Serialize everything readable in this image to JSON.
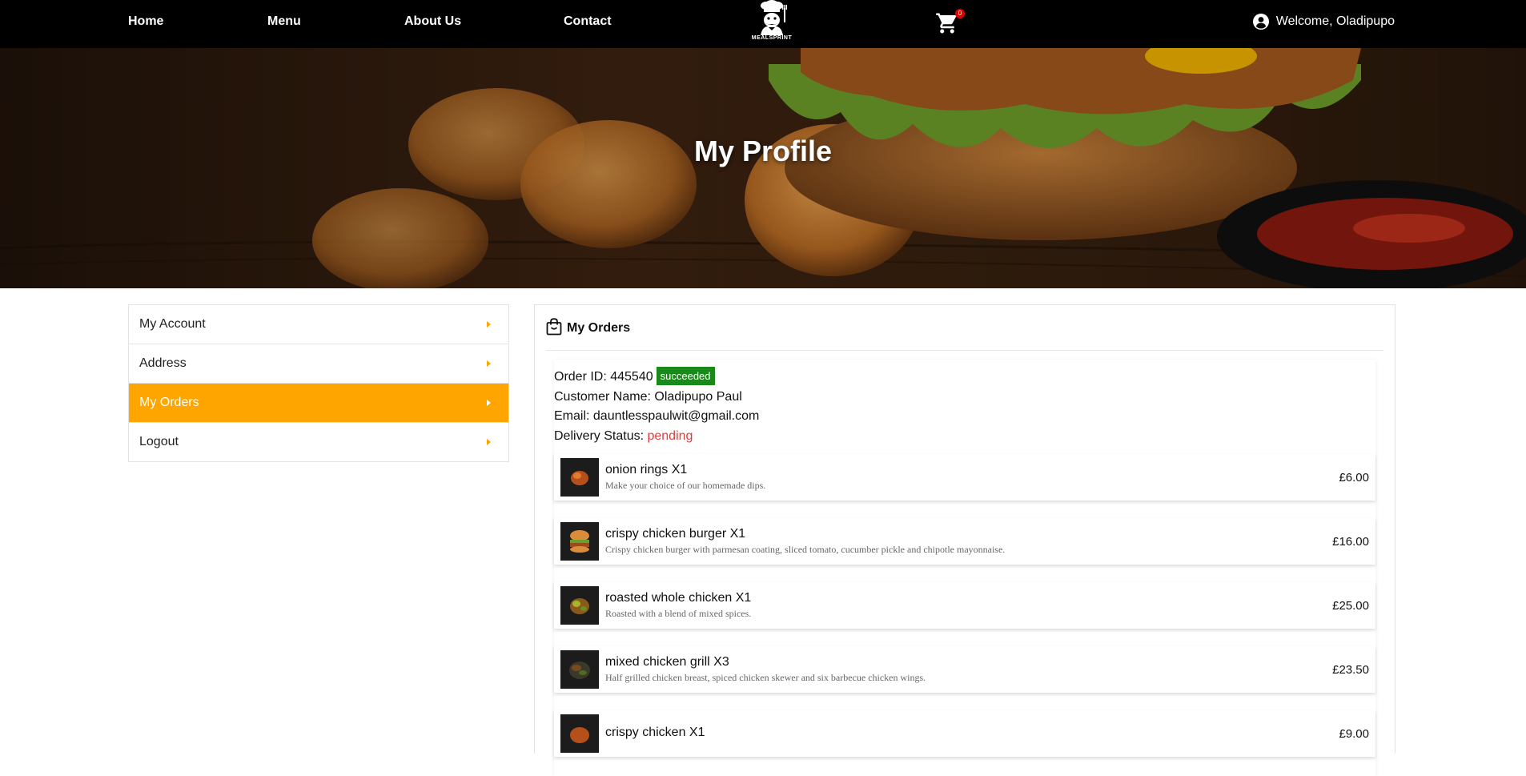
{
  "nav": {
    "links": [
      "Home",
      "Menu",
      "About Us",
      "Contact"
    ],
    "logo_text": "MEALSPRINT",
    "cart_count": "0",
    "welcome": "Welcome, Oladipupo"
  },
  "hero": {
    "title": "My Profile"
  },
  "sidebar": {
    "items": [
      {
        "label": "My Account"
      },
      {
        "label": "Address"
      },
      {
        "label": "My Orders"
      },
      {
        "label": "Logout"
      }
    ]
  },
  "orders": {
    "title": "My Orders",
    "order": {
      "id_label": "Order ID: 445540",
      "status": "succeeded",
      "customer": "Customer Name: Oladipupo Paul",
      "email": "Email: dauntlesspaulwit@gmail.com",
      "delivery_label": "Delivery Status: ",
      "delivery_status": "pending"
    },
    "items": [
      {
        "name": "onion rings X1",
        "desc": "Make your choice of our homemade dips.",
        "price": "£6.00"
      },
      {
        "name": "crispy chicken burger X1",
        "desc": "Crispy chicken burger with parmesan coating, sliced tomato, cucumber pickle and chipotle mayonnaise.",
        "price": "£16.00"
      },
      {
        "name": "roasted whole chicken X1",
        "desc": "Roasted with a blend of mixed spices.",
        "price": "£25.00"
      },
      {
        "name": "mixed chicken grill X3",
        "desc": "Half grilled chicken breast, spiced chicken skewer and six barbecue chicken wings.",
        "price": "£23.50"
      },
      {
        "name": "crispy chicken X1",
        "desc": "",
        "price": "£9.00"
      }
    ]
  },
  "colors": {
    "accent": "#ffa500",
    "success": "#198a19",
    "pending": "#e03b3b",
    "navbar": "#000000"
  }
}
